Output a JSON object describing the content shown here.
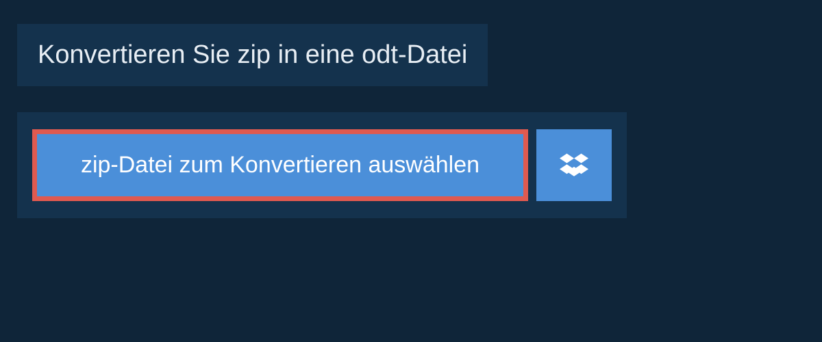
{
  "header": {
    "title": "Konvertieren Sie zip in eine odt-Datei"
  },
  "actions": {
    "select_file_label": "zip-Datei zum Konvertieren auswählen"
  },
  "colors": {
    "background": "#0f2539",
    "panel": "#14324d",
    "button": "#4b8fd9",
    "highlight_border": "#e05a50",
    "text_light": "#ffffff"
  }
}
